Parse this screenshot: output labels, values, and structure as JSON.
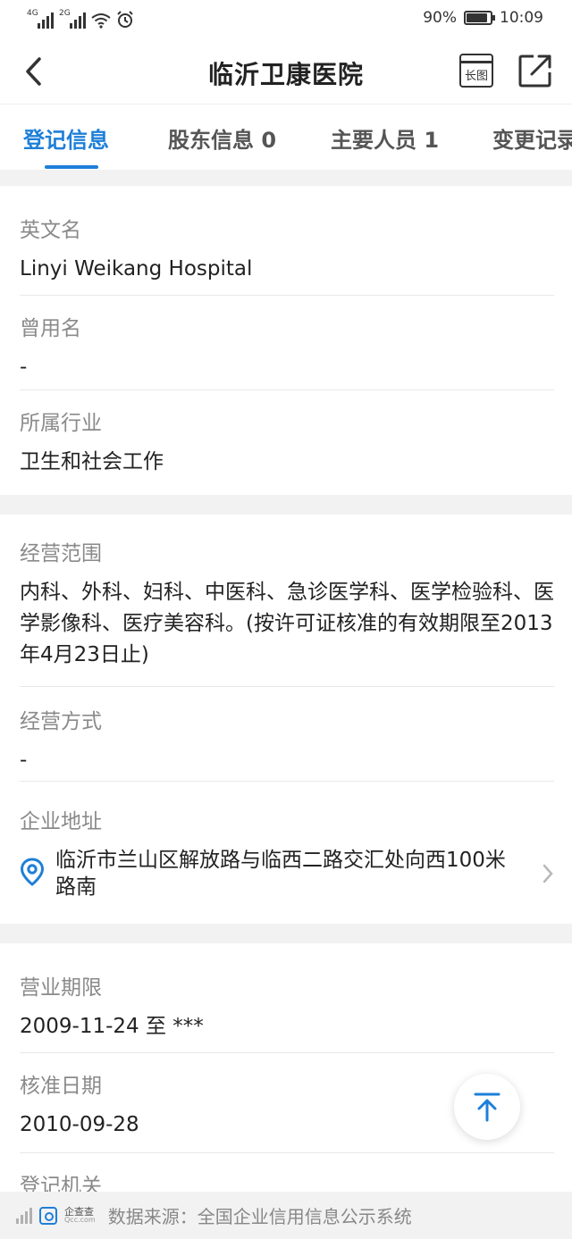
{
  "status_bar": {
    "net1": "4G",
    "net2": "2G",
    "battery": "90%",
    "time": "10:09"
  },
  "header": {
    "title": "临沂卫康医院",
    "long_image_label": "长图"
  },
  "tabs": [
    {
      "label": "登记信息",
      "active": true
    },
    {
      "label": "股东信息 0",
      "active": false
    },
    {
      "label": "主要人员 1",
      "active": false
    },
    {
      "label": "变更记录",
      "active": false
    }
  ],
  "section1": {
    "english_name": {
      "label": "英文名",
      "value": "Linyi Weikang Hospital"
    },
    "former_name": {
      "label": "曾用名",
      "value": "-"
    },
    "industry": {
      "label": "所属行业",
      "value": "卫生和社会工作"
    }
  },
  "section2": {
    "scope": {
      "label": "经营范围",
      "value": "内科、外科、妇科、中医科、急诊医学科、医学检验科、医学影像科、医疗美容科。(按许可证核准的有效期限至2013年4月23日止)"
    },
    "mode": {
      "label": "经营方式",
      "value": "-"
    },
    "address": {
      "label": "企业地址",
      "value": "临沂市兰山区解放路与临西二路交汇处向西100米路南"
    }
  },
  "section3": {
    "term": {
      "label": "营业期限",
      "value": "2009-11-24 至 ***"
    },
    "approval_date": {
      "label": "核准日期",
      "value": "2010-09-28"
    },
    "authority": {
      "label": "登记机关"
    }
  },
  "footer": {
    "logo_name": "企查查",
    "logo_domain": "Qcc.com",
    "source": "数据来源：全国企业信用信息公示系统"
  },
  "colors": {
    "accent": "#1e7fd8",
    "gap": "#f2f2f2",
    "label": "#8a8a8a"
  },
  "icons": [
    "back-icon",
    "share-icon",
    "location-icon",
    "chevron-right-icon",
    "arrow-up-icon",
    "wifi-icon",
    "alarm-icon",
    "battery-icon"
  ]
}
